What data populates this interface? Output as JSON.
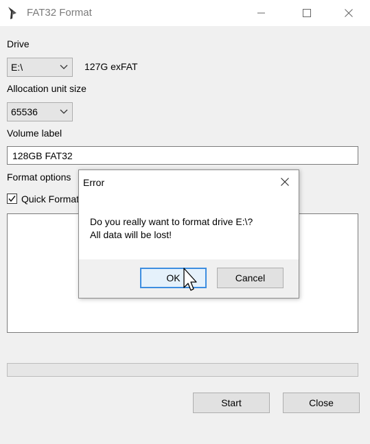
{
  "window": {
    "title": "FAT32 Format"
  },
  "drive": {
    "label": "Drive",
    "value": "E:\\",
    "info": "127G exFAT"
  },
  "allocation": {
    "label": "Allocation unit size",
    "value": "65536"
  },
  "volume": {
    "label": "Volume label",
    "value": "128GB FAT32"
  },
  "format_options": {
    "label": "Format options",
    "quick_format_label": "Quick Format",
    "quick_format_checked": true
  },
  "progress": {
    "fraction": 0
  },
  "buttons": {
    "start": "Start",
    "close": "Close"
  },
  "dialog": {
    "title": "Error",
    "message_line1": "Do you really want to format drive E:\\?",
    "message_line2": "All data will be lost!",
    "ok": "OK",
    "cancel": "Cancel"
  },
  "icons": {
    "app": "app-logo-icon",
    "minimize": "minimize-icon",
    "maximize": "maximize-icon",
    "close": "close-icon",
    "chevron": "chevron-down-icon",
    "check": "checkmark-icon",
    "cursor": "hand-cursor-icon"
  }
}
